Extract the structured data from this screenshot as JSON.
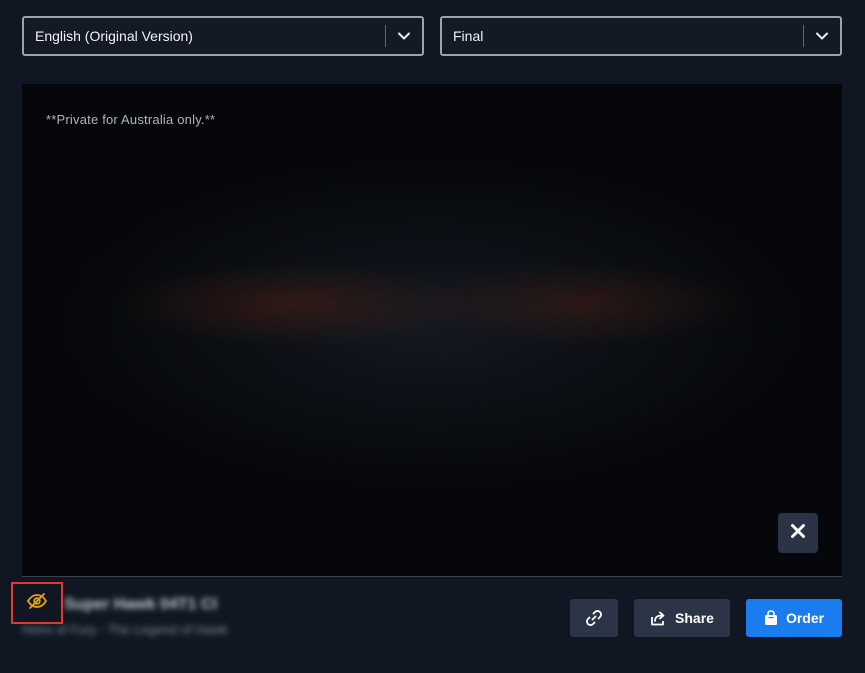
{
  "selects": {
    "language": {
      "value": "English (Original Version)"
    },
    "version": {
      "value": "Final"
    }
  },
  "player": {
    "notice": "**Private for Australia only.**"
  },
  "title_info": {
    "title": "Super Hawk 04T1 CI",
    "subtitle": "Heirs of Fury - The Legend of Hawk"
  },
  "actions": {
    "share_label": "Share",
    "order_label": "Order"
  },
  "colors": {
    "accent_blue": "#1b7cf0",
    "eye_icon": "#e2a21e",
    "highlight_red": "#e0392f"
  },
  "icons": {
    "select_chevron": "chevron-down-icon",
    "close": "close-icon",
    "visibility": "eye-off-icon",
    "link": "link-icon",
    "share": "share-icon",
    "order": "shopping-bag-icon"
  }
}
